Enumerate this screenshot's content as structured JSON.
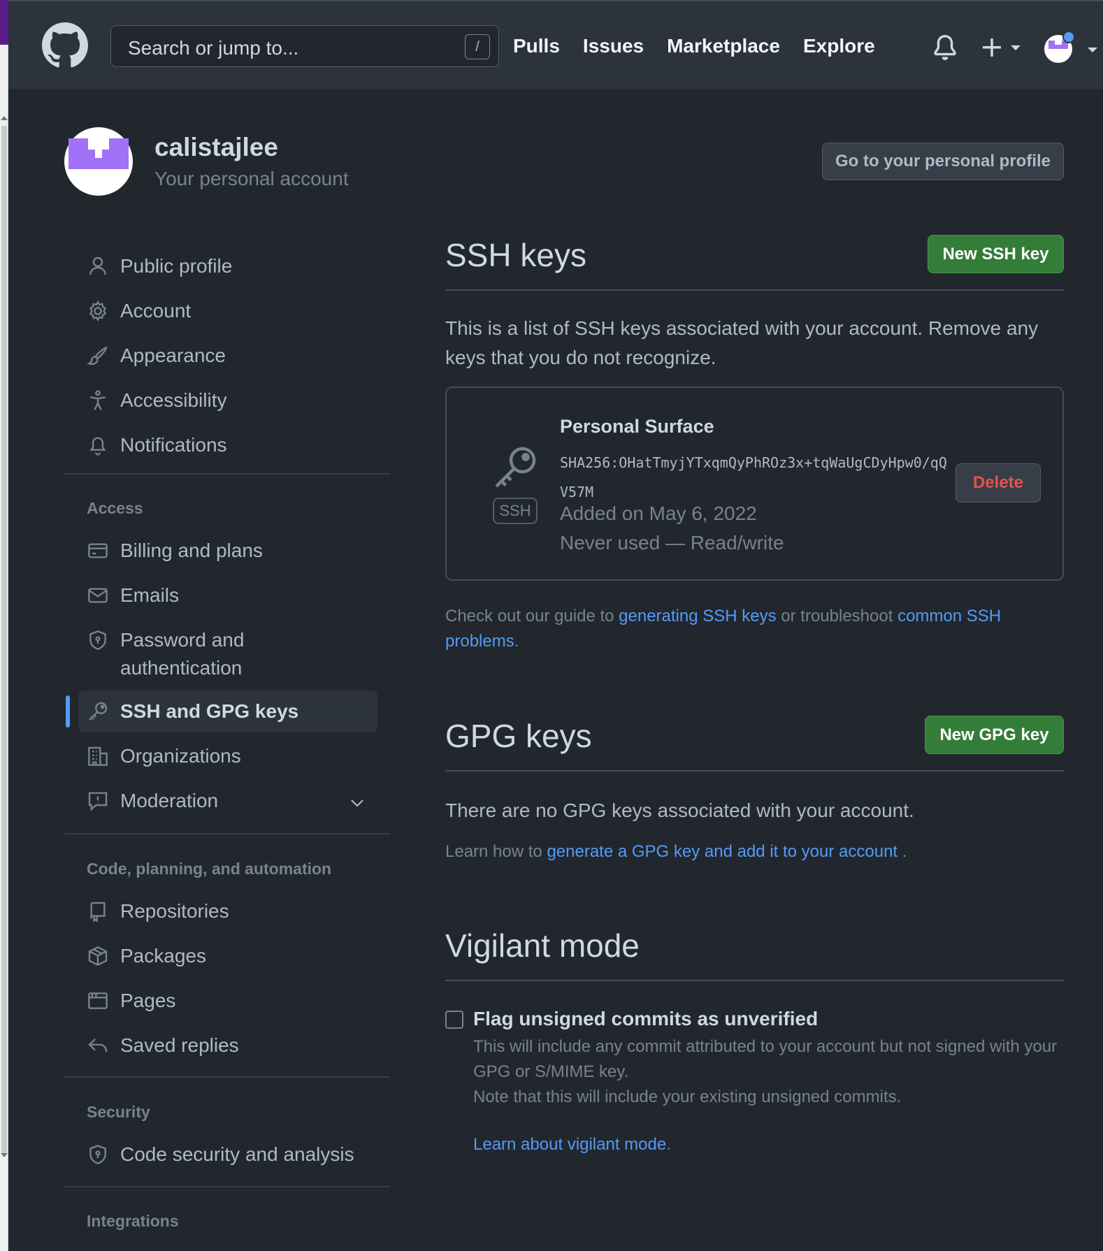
{
  "header": {
    "search_placeholder": "Search or jump to...",
    "search_shortcut": "/",
    "nav": [
      "Pulls",
      "Issues",
      "Marketplace",
      "Explore"
    ]
  },
  "profile": {
    "username": "calistajlee",
    "subtitle": "Your personal account",
    "profile_button": "Go to your personal profile"
  },
  "sidebar": {
    "items": [
      {
        "label": "Public profile",
        "icon": "person-icon"
      },
      {
        "label": "Account",
        "icon": "gear-icon"
      },
      {
        "label": "Appearance",
        "icon": "paintbrush-icon"
      },
      {
        "label": "Accessibility",
        "icon": "accessibility-icon"
      },
      {
        "label": "Notifications",
        "icon": "bell-icon"
      }
    ],
    "access_heading": "Access",
    "access_items": [
      {
        "label": "Billing and plans",
        "icon": "credit-card-icon"
      },
      {
        "label": "Emails",
        "icon": "mail-icon"
      },
      {
        "label": "Password and authentication",
        "icon": "shield-lock-icon"
      },
      {
        "label": "SSH and GPG keys",
        "icon": "key-icon",
        "active": true
      },
      {
        "label": "Organizations",
        "icon": "organization-icon"
      },
      {
        "label": "Moderation",
        "icon": "report-icon"
      }
    ],
    "code_heading": "Code, planning, and automation",
    "code_items": [
      {
        "label": "Repositories",
        "icon": "repo-icon"
      },
      {
        "label": "Packages",
        "icon": "package-icon"
      },
      {
        "label": "Pages",
        "icon": "browser-icon"
      },
      {
        "label": "Saved replies",
        "icon": "reply-icon"
      }
    ],
    "security_heading": "Security",
    "security_items": [
      {
        "label": "Code security and analysis",
        "icon": "shield-lock-icon"
      }
    ],
    "integrations_heading": "Integrations"
  },
  "ssh": {
    "title": "SSH keys",
    "new_button": "New SSH key",
    "description": "This is a list of SSH keys associated with your account. Remove any keys that you do not recognize.",
    "key": {
      "name": "Personal Surface",
      "fingerprint": "SHA256:OHatTmyjYTxqmQyPhROz3x+tqWaUgCDyHpw0/qQV57M",
      "added": "Added on May 6, 2022",
      "usage": "Never used — Read/write",
      "badge": "SSH",
      "delete_label": "Delete"
    },
    "guide_prefix": "Check out our guide to ",
    "guide_link1": "generating SSH keys",
    "guide_middle": " or troubleshoot ",
    "guide_link2": "common SSH problems",
    "guide_suffix": "."
  },
  "gpg": {
    "title": "GPG keys",
    "new_button": "New GPG key",
    "empty": "There are no GPG keys associated with your account.",
    "learn_prefix": "Learn how to ",
    "learn_link": "generate a GPG key and add it to your account",
    "learn_suffix": " ."
  },
  "vigilant": {
    "title": "Vigilant mode",
    "checkbox_label": "Flag unsigned commits as unverified",
    "checked": false,
    "desc1": "This will include any commit attributed to your account but not signed with your GPG or S/MIME key.",
    "desc2": "Note that this will include your existing unsigned commits.",
    "link": "Learn about vigilant mode",
    "link_suffix": "."
  },
  "colors": {
    "background": "#22272e",
    "header": "#2d333b",
    "accent_link": "#539bf5",
    "primary_button": "#347d39",
    "danger": "#e5534b",
    "avatar_purple": "#a371f7"
  }
}
